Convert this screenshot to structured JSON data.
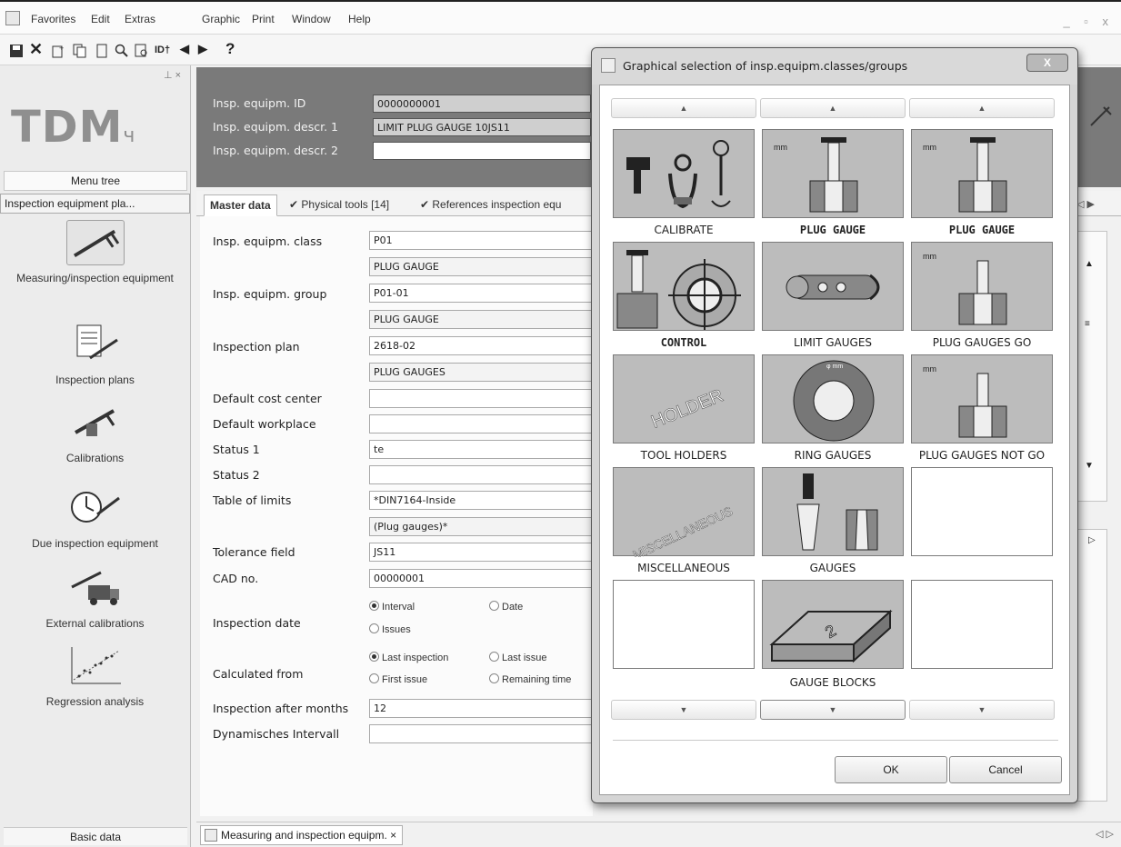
{
  "menu": [
    "Favorites",
    "Edit",
    "Extras",
    "Graphic",
    "Print",
    "Window",
    "Help"
  ],
  "window_controls": "_ ▫ x",
  "toolbar": {
    "help": "?"
  },
  "sidebar": {
    "logo": "TDM",
    "menu_tree": "Menu tree",
    "section": "Inspection equipment pla...",
    "items": [
      {
        "label": "Measuring/inspection equipment"
      },
      {
        "label": "Inspection plans"
      },
      {
        "label": "Calibrations"
      },
      {
        "label": "Due inspection equipment"
      },
      {
        "label": "External calibrations"
      },
      {
        "label": "Regression analysis"
      }
    ],
    "basic_data": "Basic data"
  },
  "header": {
    "id_label": "Insp. equipm. ID",
    "id_value": "0000000001",
    "descr1_label": "Insp. equipm. descr. 1",
    "descr1_value": "LIMIT PLUG GAUGE 10JS11",
    "descr2_label": "Insp. equipm. descr. 2",
    "descr2_value": ""
  },
  "tabs": [
    {
      "label": "Master data"
    },
    {
      "label": "Physical tools [14]"
    },
    {
      "label": "References inspection equ"
    }
  ],
  "form": {
    "class_label": "Insp. equipm. class",
    "class_value": "P01",
    "class_desc": "PLUG GAUGE",
    "group_label": "Insp. equipm. group",
    "group_value": "P01-01",
    "group_desc": "PLUG GAUGE",
    "plan_label": "Inspection plan",
    "plan_value": "2618-02",
    "plan_desc": "PLUG GAUGES",
    "cost_label": "Default cost center",
    "cost_value": "",
    "workplace_label": "Default workplace",
    "workplace_value": "",
    "status1_label": "Status 1",
    "status1_value": "te",
    "status2_label": "Status 2",
    "status2_value": "",
    "limits_label": "Table of limits",
    "limits_value1": "*DIN7164-Inside",
    "limits_value2": "(Plug gauges)*",
    "tolerance_label": "Tolerance field",
    "tolerance_value": "JS11",
    "cad_label": "CAD no.",
    "cad_value": "00000001",
    "insp_date_label": "Inspection date",
    "insp_date_opts": [
      "Interval",
      "Date",
      "Issues"
    ],
    "calc_label": "Calculated from",
    "calc_opts": [
      "Last inspection",
      "Last issue",
      "First issue",
      "Remaining time"
    ],
    "months_label": "Inspection after months",
    "months_value": "12",
    "dyn_label": "Dynamisches Intervall",
    "dyn_value": ""
  },
  "bottom_tab": "Measuring and inspection equipm.  ×",
  "dialog": {
    "title": "Graphical selection of insp.equipm.classes/groups",
    "close": "X",
    "tiles": [
      {
        "label": "CALIBRATE",
        "bold": false
      },
      {
        "label": "PLUG GAUGE",
        "bold": true
      },
      {
        "label": "PLUG GAUGE",
        "bold": true
      },
      {
        "label": "CONTROL",
        "bold": true
      },
      {
        "label": "LIMIT GAUGES",
        "bold": false
      },
      {
        "label": "PLUG GAUGES GO",
        "bold": false
      },
      {
        "label": "TOOL HOLDERS",
        "bold": false
      },
      {
        "label": "RING GAUGES",
        "bold": false
      },
      {
        "label": "PLUG GAUGES NOT GO",
        "bold": false
      },
      {
        "label": "MISCELLANEOUS",
        "bold": false
      },
      {
        "label": "GAUGES",
        "bold": false
      },
      {
        "label": "",
        "bold": false
      },
      {
        "label": "",
        "bold": false
      },
      {
        "label": "GAUGE BLOCKS",
        "bold": false
      },
      {
        "label": "",
        "bold": false
      }
    ],
    "holder_text": "HOLDER",
    "misc_text": "MISCELLANEOUS",
    "mm_text": "mm",
    "ok": "OK",
    "cancel": "Cancel"
  },
  "colors": {
    "header_bg": "#7a7a7a",
    "tile_bg": "#bcbcbc"
  }
}
